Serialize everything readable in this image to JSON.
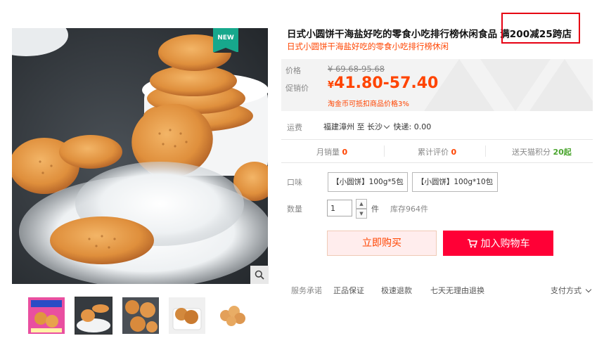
{
  "product": {
    "title": "日式小圆饼干海盐好吃的零食小吃排行榜休闲食品",
    "promo_tag": "满200减25跨店",
    "subtitle": "日式小圆饼干海盐好吃的零食小吃排行榜休闲",
    "badge": "NEW"
  },
  "price": {
    "price_label": "价格",
    "original": "¥ 69.68-95.68",
    "promo_label": "促销价",
    "currency": "¥",
    "promo_value": "41.80-57.40",
    "taojinbi_note": "淘金币可抵扣商品价格3%"
  },
  "shipping": {
    "label": "运费",
    "from": "福建漳州",
    "to_word": "至",
    "to": "长沙",
    "method": "快递: 0.00"
  },
  "stats": {
    "monthly_sales_label": "月销量",
    "monthly_sales": "0",
    "reviews_label": "累计评价",
    "reviews": "0",
    "points_label": "送天猫积分",
    "points": "20起"
  },
  "options": {
    "flavor_label": "口味",
    "items": [
      "【小圆饼】100g*5包",
      "【小圆饼】100g*10包"
    ]
  },
  "quantity": {
    "label": "数量",
    "value": "1",
    "unit": "件",
    "stock": "库存964件"
  },
  "actions": {
    "buy_now": "立即购买",
    "add_to_cart": "加入购物车"
  },
  "services": {
    "label": "服务承诺",
    "items": [
      "正品保证",
      "极速退款",
      "七天无理由退换"
    ],
    "payment": "支付方式"
  },
  "colors": {
    "accent": "#ff0036",
    "price": "#ff4400",
    "badge": "#17a88c",
    "promo_border": "#e60012"
  }
}
